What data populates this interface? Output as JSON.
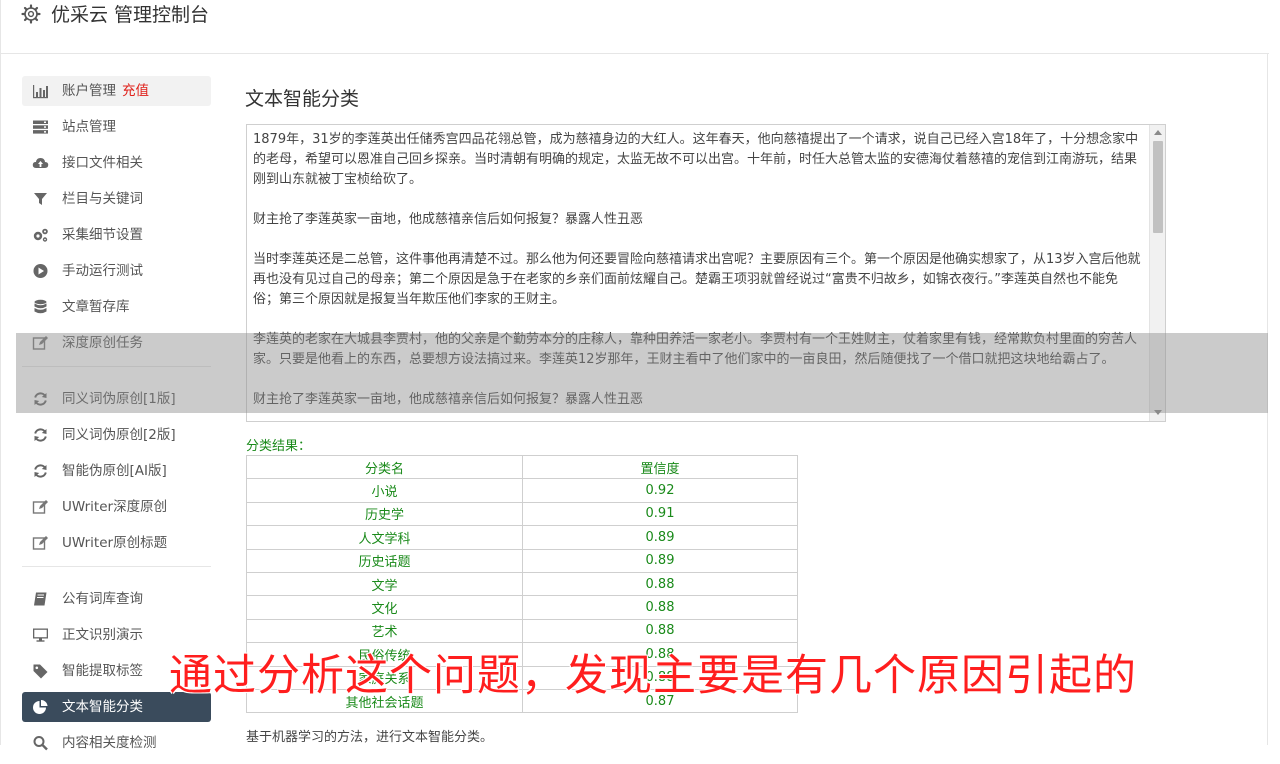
{
  "header": {
    "title": "优采云 管理控制台",
    "icon": "gear-icon"
  },
  "sidebar": {
    "group1": [
      {
        "label": "账户管理",
        "badge": "充值",
        "icon": "bar-chart-icon"
      },
      {
        "label": "站点管理",
        "icon": "server-icon"
      },
      {
        "label": "接口文件相关",
        "icon": "cloud-upload-icon"
      },
      {
        "label": "栏目与关键词",
        "icon": "filter-icon"
      },
      {
        "label": "采集细节设置",
        "icon": "cogs-icon"
      },
      {
        "label": "手动运行测试",
        "icon": "play-circle-icon"
      },
      {
        "label": "文章暂存库",
        "icon": "database-icon"
      },
      {
        "label": "深度原创任务",
        "icon": "edit-icon"
      }
    ],
    "group2": [
      {
        "label": "同义词伪原创[1版]",
        "icon": "refresh-icon"
      },
      {
        "label": "同义词伪原创[2版]",
        "icon": "refresh-icon"
      },
      {
        "label": "智能伪原创[AI版]",
        "icon": "refresh-icon"
      },
      {
        "label": "UWriter深度原创",
        "icon": "edit-icon"
      },
      {
        "label": "UWriter原创标题",
        "icon": "edit-icon"
      }
    ],
    "group3": [
      {
        "label": "公有词库查询",
        "icon": "book-icon"
      },
      {
        "label": "正文识别演示",
        "icon": "desktop-icon"
      },
      {
        "label": "智能提取标签",
        "icon": "tag-icon"
      },
      {
        "label": "文本智能分类",
        "icon": "pie-chart-icon"
      },
      {
        "label": "内容相关度检测",
        "icon": "search-icon"
      }
    ]
  },
  "main": {
    "title": "文本智能分类",
    "text_paragraphs": [
      "1879年，31岁的李莲英出任储秀宫四品花翎总管，成为慈禧身边的大红人。这年春天，他向慈禧提出了一个请求，说自己已经入宫18年了，十分想念家中的老母，希望可以恩准自己回乡探亲。当时清朝有明确的规定，太监无故不可以出宫。十年前，时任大总管太监的安德海仗着慈禧的宠信到江南游玩，结果刚到山东就被丁宝桢给砍了。",
      "财主抢了李莲英家一亩地，他成慈禧亲信后如何报复？暴露人性丑恶",
      "当时李莲英还是二总管，这件事他再清楚不过。那么他为何还要冒险向慈禧请求出宫呢？主要原因有三个。第一个原因是他确实想家了，从13岁入宫后他就再也没有见过自己的母亲；第二个原因是急于在老家的乡亲们面前炫耀自己。楚霸王项羽就曾经说过“富贵不归故乡，如锦衣夜行。”李莲英自然也不能免俗；第三个原因就是报复当年欺压他们李家的王财主。",
      "李莲英的老家在大城县李贾村，他的父亲是个勤劳本分的庄稼人，靠种田养活一家老小。李贾村有一个王姓财主，仗着家里有钱，经常欺负村里面的穷苦人家。只要是他看上的东西，总要想方设法搞过来。李莲英12岁那年，王财主看中了他们家中的一亩良田，然后随便找了一个借口就把这块地给霸占了。",
      "财主抢了李莲英家一亩地，他成慈禧亲信后如何报复？暴露人性丑恶"
    ],
    "result_label": "分类结果：",
    "table_headers": [
      "分类名",
      "置信度"
    ],
    "table_rows": [
      [
        "小说",
        "0.92"
      ],
      [
        "历史学",
        "0.91"
      ],
      [
        "人文学科",
        "0.89"
      ],
      [
        "历史话题",
        "0.89"
      ],
      [
        "文学",
        "0.88"
      ],
      [
        "文化",
        "0.88"
      ],
      [
        "艺术",
        "0.88"
      ],
      [
        "民俗传统",
        "0.88"
      ],
      [
        "家庭关系",
        "0.88"
      ],
      [
        "其他社会话题",
        "0.87"
      ]
    ],
    "footer_note": "基于机器学习的方法，进行文本智能分类。"
  },
  "overlay": {
    "subtitle": "通过分析这个问题，发现主要是有几个原因引起的"
  },
  "colors": {
    "accent_red": "#e0201a",
    "active_nav": "#3a4b5c",
    "result_green": "#1a8a1a",
    "subtitle_red": "#ff1e1e"
  }
}
